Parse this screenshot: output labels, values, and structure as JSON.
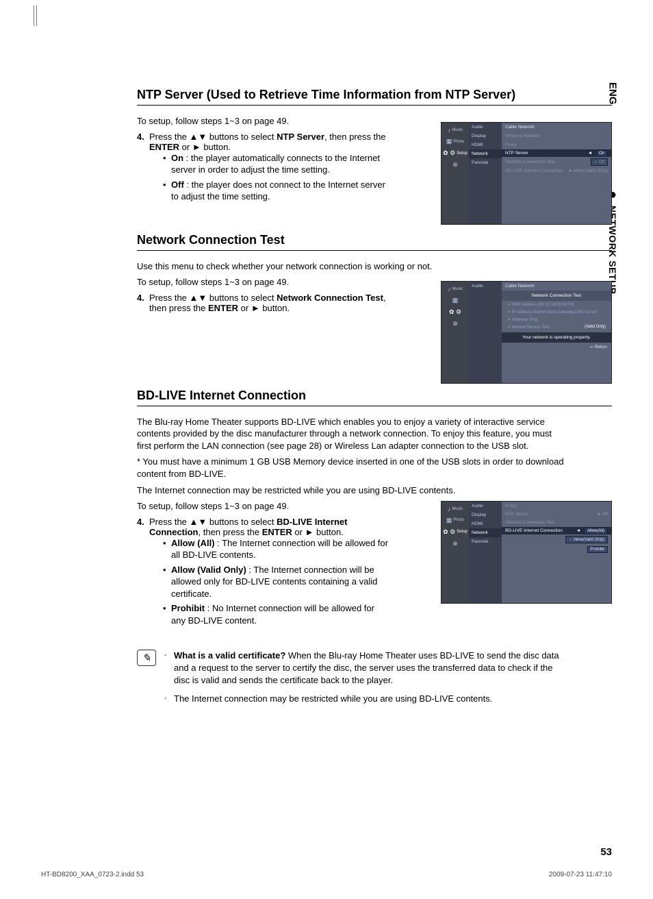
{
  "sidebar": {
    "lang": "ENG",
    "section": "NETWORK SETUP"
  },
  "page_num": "53",
  "footer": {
    "left": "HT-BD8200_XAA_0723-2.indd   53",
    "right": "2009-07-23   11:47:10"
  },
  "s1": {
    "title": "NTP Server (Used to Retrieve Time Information from NTP Server)",
    "intro": "To setup, follow steps 1~3 on page 49.",
    "step_num": "4.",
    "step_a": "Press the ▲▼ buttons to select ",
    "step_bold1": "NTP Server",
    "step_b": ", then press the ",
    "step_bold2": "ENTER",
    "step_c": " or ► button.",
    "on_label": "On",
    "on_text": " : the player automatically connects to the Internet server in order to adjust the time setting.",
    "off_label": "Off",
    "off_text": " : the player does not connect to the Internet server to adjust the time setting."
  },
  "s2": {
    "title": "Network Connection Test",
    "intro": "Use this menu to check whether your network connection is working or not.",
    "intro2": "To setup, follow steps 1~3 on page 49.",
    "step_num": "4.",
    "step_a": "Press the ▲▼ buttons to select ",
    "step_bold1": "Network Connection Test",
    "step_b": ", then press the ",
    "step_bold2": "ENTER",
    "step_c": " or ► button."
  },
  "s3": {
    "title": "BD-LIVE Internet Connection",
    "p1": "The Blu-ray Home Theater supports BD-LIVE which enables you to enjoy a variety of interactive service contents provided by the disc manufacturer through a network connection. To enjoy this feature, you must first perform the LAN connection (see page 28) or Wireless Lan adapter connection to the USB slot.",
    "p2": "* You must have a minimum 1 GB USB Memory device inserted in one of the USB slots in order to download content from BD-LIVE.",
    "p3": "The Internet connection may be restricted while you are using BD-LIVE contents.",
    "p4": "To setup, follow steps 1~3 on page 49.",
    "step_num": "4.",
    "step_a": "Press the ▲▼ buttons to select ",
    "step_bold1": "BD-LIVE Internet Connection",
    "step_b": ", then press the ",
    "step_bold2": "ENTER",
    "step_c": " or ► button.",
    "b1_label": "Allow (All)",
    "b1_text": " : The Internet connection will be allowed for all BD-LIVE contents.",
    "b2_label": "Allow (Valid Only)",
    "b2_text": " : The Internet connection will be allowed only for BD-LIVE contents containing a valid certificate.",
    "b3_label": "Prohibit",
    "b3_text": " : No Internet connection will be allowed for any BD-LIVE content."
  },
  "notes": {
    "n1_bold": "What is a valid certificate?",
    "n1_text": " When the Blu-ray Home Theater uses BD-LIVE to send the disc data and a request to the server to certify the disc, the server uses the transferred data to check if the disc is valid and sends the certificate back to the player.",
    "n2": "The Internet connection may be restricted while you are using BD-LIVE contents."
  },
  "shot_menu": {
    "icons": {
      "music": "Music",
      "photo": "Photo",
      "setup": "Setup"
    },
    "items": [
      "Audio",
      "Display",
      "HDMI",
      "Network",
      "Parental"
    ],
    "selected": "Network"
  },
  "shot1": {
    "rows": {
      "cable": "Cable Network",
      "wireless": "Wireless Network",
      "proxy": "Proxy",
      "ntp": "NTP Server",
      "ntp_val": "On",
      "ntp_opt2": "Off",
      "nettest": "Network Connection Test",
      "bdlive": "BD-LIVE Internet Connection",
      "bdlive_val": "Allow (Valid Only)"
    }
  },
  "shot2": {
    "hdr": "Cable Network",
    "title": "Network Connection Test",
    "l1": "MAC Address (00:10:18:00:00:70)",
    "l2": "IP Address,Subnet Mask,Gateway,DNS Server",
    "l3": "Gateway Ping",
    "l4": "Internet Service Test",
    "l4r": "(Valid Only)",
    "ok": "Your network is operating properly.",
    "ret": "↩ Return"
  },
  "shot3": {
    "rows": {
      "proxy": "Proxy",
      "ntp": "NTP Server",
      "ntp_val": "Off",
      "nettest": "Network Connection Test",
      "bdlive": "BD-LIVE Internet Connection",
      "bdlive_val": "Allow(All)",
      "opt2": "Allow(Valid Only)",
      "opt3": "Prohibit"
    }
  }
}
